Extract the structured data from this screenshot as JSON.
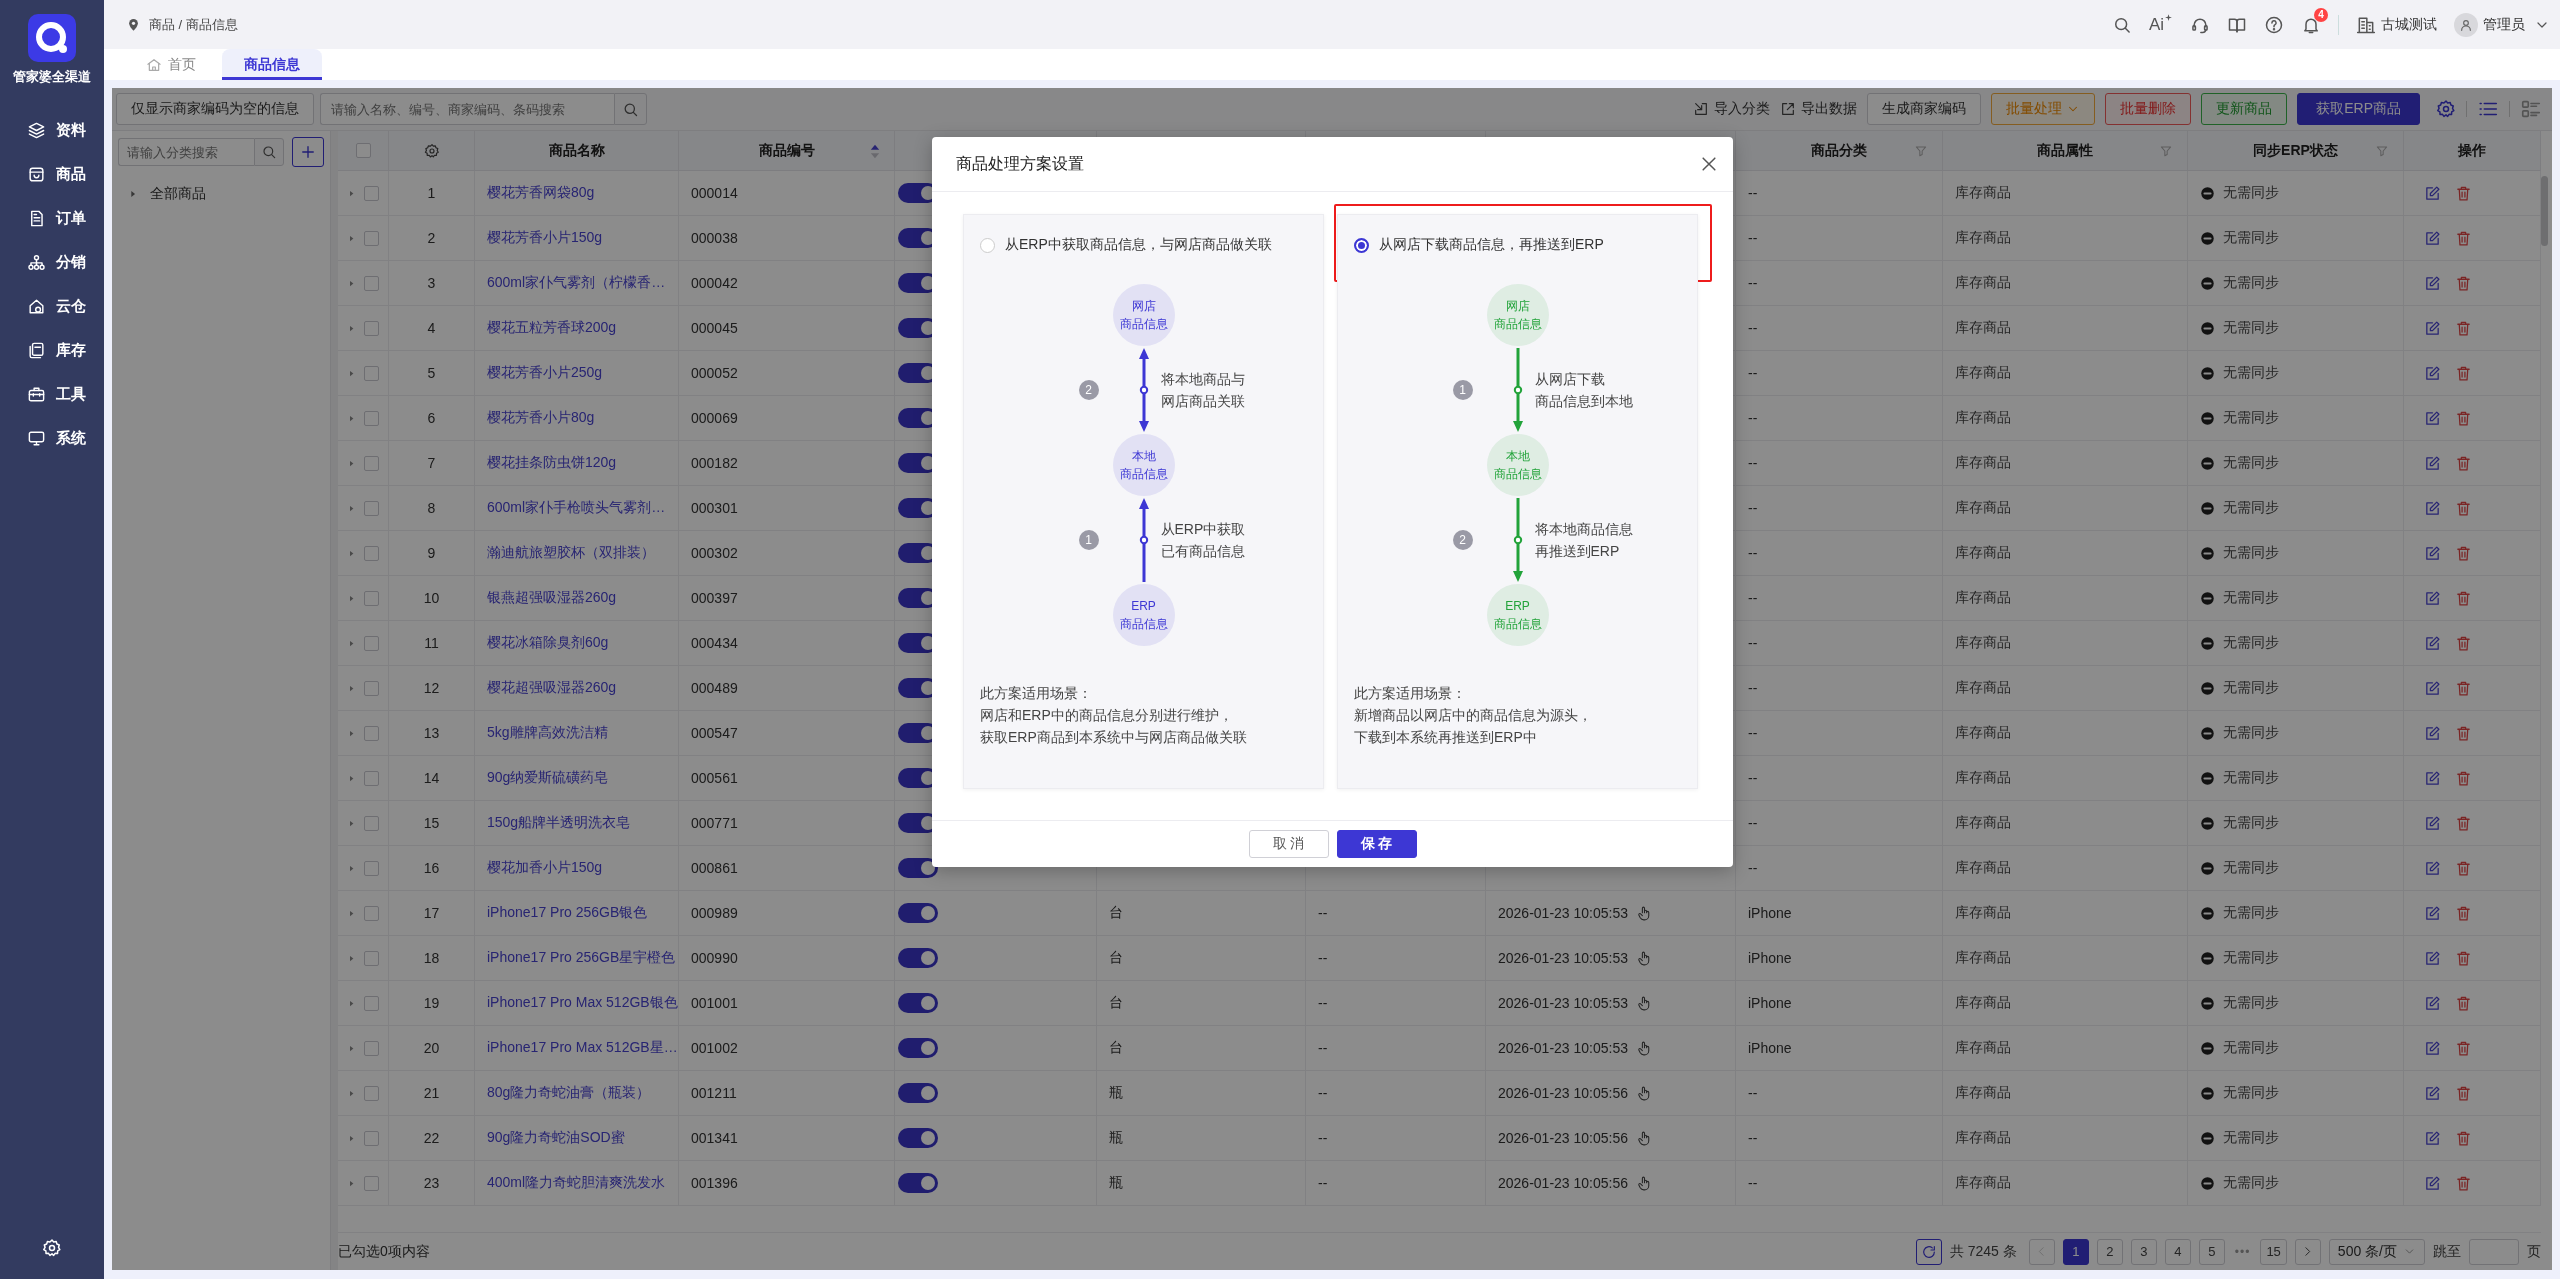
{
  "app": {
    "brand": "管家婆全渠道"
  },
  "nav": [
    {
      "label": "资料",
      "selected": false
    },
    {
      "label": "商品",
      "selected": false
    },
    {
      "label": "订单",
      "selected": false
    },
    {
      "label": "分销",
      "selected": false
    },
    {
      "label": "云仓",
      "selected": false
    },
    {
      "label": "库存",
      "selected": false
    },
    {
      "label": "工具",
      "selected": false
    },
    {
      "label": "系统",
      "selected": false
    }
  ],
  "breadcrumb": "商品 / 商品信息",
  "header": {
    "ai_label": "Ai",
    "notification_count": "4",
    "store": "古城测试",
    "user": "管理员"
  },
  "tabs": [
    {
      "label": "首页",
      "selected": false,
      "kind": "home"
    },
    {
      "label": "商品信息",
      "selected": true,
      "kind": "page"
    }
  ],
  "toolbar": {
    "filter_button": "仅显示商家编码为空的信息",
    "search_placeholder": "请输入名称、编号、商家编码、条码搜索",
    "links": [
      "导入分类",
      "导出数据"
    ],
    "buttons": [
      {
        "label": "生成商家编码",
        "kind": "default"
      },
      {
        "label": "批量处理",
        "kind": "warning",
        "dropdown": true
      },
      {
        "label": "批量删除",
        "kind": "danger"
      },
      {
        "label": "更新商品",
        "kind": "success"
      },
      {
        "label": "获取ERP商品",
        "kind": "primary"
      }
    ],
    "views": [
      {
        "kind": "list",
        "selected": true
      },
      {
        "kind": "cards",
        "selected": false
      }
    ]
  },
  "category_tree": {
    "search_placeholder": "请输入分类搜索",
    "items": [
      {
        "label": "全部商品",
        "expanded": false
      }
    ]
  },
  "table": {
    "all_checked": false,
    "columns": [
      {
        "kind": "select"
      },
      {
        "kind": "settings"
      },
      {
        "kind": "text",
        "label": "商品名称"
      },
      {
        "kind": "sort",
        "label": "商品编号",
        "sorted_ascending": true
      },
      {
        "kind": "covered"
      },
      {
        "kind": "covered"
      },
      {
        "kind": "covered"
      },
      {
        "kind": "covered"
      },
      {
        "kind": "filter",
        "label": "商品分类"
      },
      {
        "kind": "filter",
        "label": "商品属性"
      },
      {
        "kind": "filter",
        "label": "同步ERP状态"
      },
      {
        "kind": "text",
        "label": "操作"
      }
    ],
    "rows": [
      {
        "index": "1",
        "name": "樱花芳香网袋80g",
        "code": "000014",
        "enabled": true,
        "category": "--",
        "attribute": "库存商品",
        "sync": "无需同步",
        "checked": false
      },
      {
        "index": "2",
        "name": "樱花芳香小片150g",
        "code": "000038",
        "enabled": true,
        "category": "--",
        "attribute": "库存商品",
        "sync": "无需同步",
        "checked": false
      },
      {
        "index": "3",
        "name": "600ml家仆气雾剂（柠檬香…",
        "code": "000042",
        "enabled": true,
        "category": "--",
        "attribute": "库存商品",
        "sync": "无需同步",
        "checked": false
      },
      {
        "index": "4",
        "name": "樱花五粒芳香球200g",
        "code": "000045",
        "enabled": true,
        "category": "--",
        "attribute": "库存商品",
        "sync": "无需同步",
        "checked": false
      },
      {
        "index": "5",
        "name": "樱花芳香小片250g",
        "code": "000052",
        "enabled": true,
        "category": "--",
        "attribute": "库存商品",
        "sync": "无需同步",
        "checked": false
      },
      {
        "index": "6",
        "name": "樱花芳香小片80g",
        "code": "000069",
        "enabled": true,
        "category": "--",
        "attribute": "库存商品",
        "sync": "无需同步",
        "checked": false
      },
      {
        "index": "7",
        "name": "樱花挂条防虫饼120g",
        "code": "000182",
        "enabled": true,
        "category": "--",
        "attribute": "库存商品",
        "sync": "无需同步",
        "checked": false
      },
      {
        "index": "8",
        "name": "600ml家仆手枪喷头气雾剂…",
        "code": "000301",
        "enabled": true,
        "category": "--",
        "attribute": "库存商品",
        "sync": "无需同步",
        "checked": false
      },
      {
        "index": "9",
        "name": "瀚迪航旅塑胶杯（双排装）",
        "code": "000302",
        "enabled": true,
        "category": "--",
        "attribute": "库存商品",
        "sync": "无需同步",
        "checked": false
      },
      {
        "index": "10",
        "name": "银燕超强吸湿器260g",
        "code": "000397",
        "enabled": true,
        "category": "--",
        "attribute": "库存商品",
        "sync": "无需同步",
        "checked": false
      },
      {
        "index": "11",
        "name": "樱花冰箱除臭剂60g",
        "code": "000434",
        "enabled": true,
        "category": "--",
        "attribute": "库存商品",
        "sync": "无需同步",
        "checked": false
      },
      {
        "index": "12",
        "name": "樱花超强吸湿器260g",
        "code": "000489",
        "enabled": true,
        "category": "--",
        "attribute": "库存商品",
        "sync": "无需同步",
        "checked": false
      },
      {
        "index": "13",
        "name": "5kg雕牌高效洗洁精",
        "code": "000547",
        "enabled": true,
        "category": "--",
        "attribute": "库存商品",
        "sync": "无需同步",
        "checked": false
      },
      {
        "index": "14",
        "name": "90g纳爱斯硫磺药皂",
        "code": "000561",
        "enabled": true,
        "category": "--",
        "attribute": "库存商品",
        "sync": "无需同步",
        "checked": false
      },
      {
        "index": "15",
        "name": "150g船牌半透明洗衣皂",
        "code": "000771",
        "enabled": true,
        "category": "--",
        "attribute": "库存商品",
        "sync": "无需同步",
        "checked": false
      },
      {
        "index": "16",
        "name": "樱花加香小片150g",
        "code": "000861",
        "enabled": true,
        "category": "--",
        "attribute": "库存商品",
        "sync": "无需同步",
        "checked": false
      },
      {
        "index": "17",
        "name": "iPhone17 Pro 256GB银色",
        "code": "000989",
        "enabled": true,
        "unit": "台",
        "column_7": "--",
        "time": "2026-01-23 10:05:53",
        "category": "iPhone",
        "attribute": "库存商品",
        "sync": "无需同步",
        "checked": false
      },
      {
        "index": "18",
        "name": "iPhone17 Pro 256GB星宇橙色",
        "code": "000990",
        "enabled": true,
        "unit": "台",
        "column_7": "--",
        "time": "2026-01-23 10:05:53",
        "category": "iPhone",
        "attribute": "库存商品",
        "sync": "无需同步",
        "checked": false
      },
      {
        "index": "19",
        "name": "iPhone17 Pro Max 512GB银色",
        "code": "001001",
        "enabled": true,
        "unit": "台",
        "column_7": "--",
        "time": "2026-01-23 10:05:53",
        "category": "iPhone",
        "attribute": "库存商品",
        "sync": "无需同步",
        "checked": false
      },
      {
        "index": "20",
        "name": "iPhone17 Pro Max 512GB星…",
        "code": "001002",
        "enabled": true,
        "unit": "台",
        "column_7": "--",
        "time": "2026-01-23 10:05:53",
        "category": "iPhone",
        "attribute": "库存商品",
        "sync": "无需同步",
        "checked": false
      },
      {
        "index": "21",
        "name": "80g隆力奇蛇油膏（瓶装）",
        "code": "001211",
        "enabled": true,
        "unit": "瓶",
        "column_7": "--",
        "time": "2026-01-23 10:05:56",
        "category": "--",
        "attribute": "库存商品",
        "sync": "无需同步",
        "checked": false
      },
      {
        "index": "22",
        "name": "90g隆力奇蛇油SOD蜜",
        "code": "001341",
        "enabled": true,
        "unit": "瓶",
        "column_7": "--",
        "time": "2026-01-23 10:05:56",
        "category": "--",
        "attribute": "库存商品",
        "sync": "无需同步",
        "checked": false
      },
      {
        "index": "23",
        "name": "400ml隆力奇蛇胆清爽洗发水",
        "code": "001396",
        "enabled": true,
        "unit": "瓶",
        "column_7": "--",
        "time": "2026-01-23 10:05:56",
        "category": "--",
        "attribute": "库存商品",
        "sync": "无需同步",
        "checked": false
      }
    ]
  },
  "footer": {
    "selection": "已勾选0项内容",
    "total": "共 7245 条",
    "prev_disabled": true,
    "next_disabled": false,
    "pages": [
      {
        "label": "1",
        "selected": true
      },
      {
        "label": "2",
        "selected": false
      },
      {
        "label": "3",
        "selected": false
      },
      {
        "label": "4",
        "selected": false
      },
      {
        "label": "5",
        "selected": false
      },
      {
        "label": "•••",
        "kind": "ellipsis"
      },
      {
        "label": "15",
        "selected": false
      }
    ],
    "page_size": "500 条/页",
    "jump_label": "跳至",
    "page_unit": "页"
  },
  "modal": {
    "title": "商品处理方案设置",
    "options": [
      {
        "label": "从ERP中获取商品信息，与网店商品做关联",
        "selected": false,
        "highlighted": false,
        "color": "#3d37d4",
        "flow": [
          {
            "kind": "node",
            "lines": [
              "网店",
              "商品信息"
            ]
          },
          {
            "kind": "step",
            "number": "2",
            "arrow_up": true,
            "arrow_down": true,
            "lines": [
              "将本地商品与",
              "网店商品关联"
            ]
          },
          {
            "kind": "node",
            "lines": [
              "本地",
              "商品信息"
            ]
          },
          {
            "kind": "step",
            "number": "1",
            "arrow_up": true,
            "arrow_down": false,
            "lines": [
              "从ERP中获取",
              "已有商品信息"
            ]
          },
          {
            "kind": "node",
            "lines": [
              "ERP",
              "商品信息"
            ]
          }
        ],
        "description": [
          "此方案适用场景：",
          "网店和ERP中的商品信息分别进行维护，",
          "获取ERP商品到本系统中与网店商品做关联"
        ]
      },
      {
        "label": "从网店下载商品信息，再推送到ERP",
        "selected": true,
        "highlighted": true,
        "color": "#22a33a",
        "flow": [
          {
            "kind": "node",
            "lines": [
              "网店",
              "商品信息"
            ]
          },
          {
            "kind": "step",
            "number": "1",
            "arrow_up": false,
            "arrow_down": true,
            "lines": [
              "从网店下载",
              "商品信息到本地"
            ]
          },
          {
            "kind": "node",
            "lines": [
              "本地",
              "商品信息"
            ]
          },
          {
            "kind": "step",
            "number": "2",
            "arrow_up": false,
            "arrow_down": true,
            "lines": [
              "将本地商品信息",
              "再推送到ERP"
            ]
          },
          {
            "kind": "node",
            "lines": [
              "ERP",
              "商品信息"
            ]
          }
        ],
        "description": [
          "此方案适用场景：",
          "新增商品以网店中的商品信息为源头，",
          "下载到本系统再推送到ERP中"
        ]
      }
    ],
    "buttons": [
      {
        "label": "取 消",
        "kind": "default"
      },
      {
        "label": "保 存",
        "kind": "primary"
      }
    ]
  }
}
